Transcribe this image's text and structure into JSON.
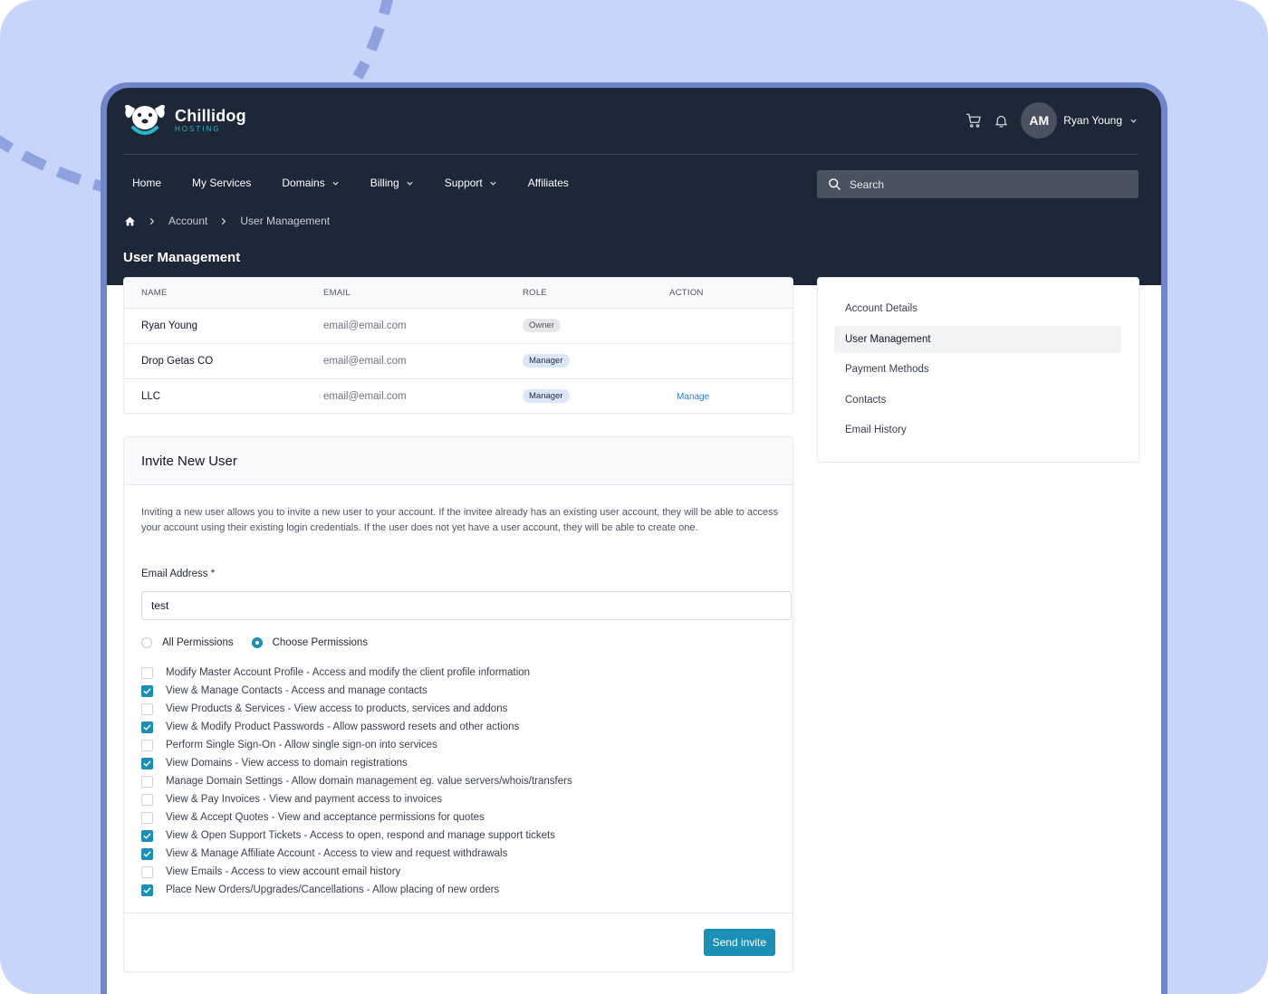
{
  "brand": {
    "name": "Chillidog",
    "sub": "HOSTING"
  },
  "header": {
    "avatar_initials": "AM",
    "user_name": "Ryan Young",
    "icons": [
      "cart-icon",
      "bell-icon",
      "chevron-down-icon"
    ]
  },
  "nav": {
    "items": [
      {
        "label": "Home",
        "dropdown": false
      },
      {
        "label": "My Services",
        "dropdown": false
      },
      {
        "label": "Domains",
        "dropdown": true
      },
      {
        "label": "Billing",
        "dropdown": true
      },
      {
        "label": "Support",
        "dropdown": true
      },
      {
        "label": "Affiliates",
        "dropdown": false
      }
    ],
    "search_placeholder": "Search"
  },
  "breadcrumb": {
    "items": [
      "Account",
      "User Management"
    ]
  },
  "page_title": "User Management",
  "users_table": {
    "headers": {
      "name": "NAME",
      "email": "EMAIL",
      "role": "ROLE",
      "action": "ACTION"
    },
    "rows": [
      {
        "name": "Ryan Young",
        "email": "email@email.com",
        "role": "Owner",
        "action": ""
      },
      {
        "name": "Drop Getas CO",
        "email": "email@email.com",
        "role": "Manager",
        "action": ""
      },
      {
        "name": "LLC",
        "email": "email@email.com",
        "role": "Manager",
        "action": "Manage"
      }
    ]
  },
  "invite": {
    "title": "Invite New User",
    "description": "Inviting a new user allows you to invite a new user to your account. If the invitee already has an existing user account, they will be able to access your account using their existing login credentials. If the user does not yet have a user account, they will be able to create one.",
    "email_label": "Email Address *",
    "email_value": "test",
    "radio_all": "All Permissions",
    "radio_choose": "Choose Permissions",
    "radio_selected": "choose",
    "permissions": [
      {
        "label": "Modify Master Account Profile - Access and modify the client profile information",
        "checked": false
      },
      {
        "label": "View & Manage Contacts - Access and manage contacts",
        "checked": true
      },
      {
        "label": "View Products & Services - View access to products, services and addons",
        "checked": false
      },
      {
        "label": "View & Modify Product Passwords - Allow password resets and other actions",
        "checked": true
      },
      {
        "label": "Perform Single Sign-On - Allow single sign-on into services",
        "checked": false
      },
      {
        "label": "View Domains - View access to domain registrations",
        "checked": true
      },
      {
        "label": "Manage Domain Settings - Allow domain management eg. value servers/whois/transfers",
        "checked": false
      },
      {
        "label": "View & Pay Invoices - View and payment access to invoices",
        "checked": false
      },
      {
        "label": "View & Accept Quotes - View and acceptance permissions for quotes",
        "checked": false
      },
      {
        "label": "View & Open Support Tickets - Access to open, respond and manage support tickets",
        "checked": true
      },
      {
        "label": "View & Manage Affiliate Account - Access to view and request withdrawals",
        "checked": true
      },
      {
        "label": "View Emails - Access to view account email history",
        "checked": false
      },
      {
        "label": "Place New Orders/Upgrades/Cancellations - Allow placing of new orders",
        "checked": true
      }
    ],
    "send_label": "Send invite"
  },
  "side_menu": {
    "items": [
      {
        "label": "Account Details",
        "active": false
      },
      {
        "label": "User Management",
        "active": true
      },
      {
        "label": "Payment Methods",
        "active": false
      },
      {
        "label": "Contacts",
        "active": false
      },
      {
        "label": "Email History",
        "active": false
      }
    ]
  },
  "colors": {
    "dark_header": "#1e2737",
    "accent": "#1c8fb6",
    "link": "#2a7fd4",
    "background": "#c7d4fb"
  }
}
